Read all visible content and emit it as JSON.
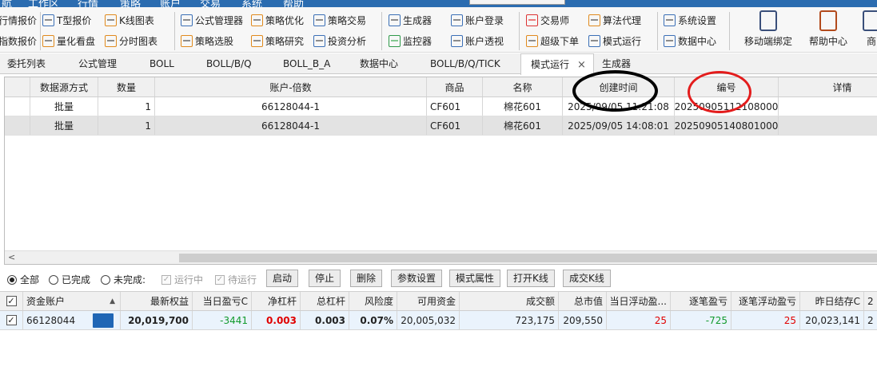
{
  "menubar": {
    "items": [
      "工作区",
      "行情",
      "策略",
      "账户",
      "交易",
      "系统",
      "帮助"
    ],
    "fragment": "航"
  },
  "ribbon": {
    "row1": [
      {
        "label": "行情报价",
        "icon": "quote-list-icon"
      },
      {
        "label": "T型报价",
        "icon": "t-quote-icon"
      },
      {
        "label": "K线图表",
        "icon": "candlestick-icon"
      },
      {
        "label": "公式管理器",
        "icon": "formula-icon"
      },
      {
        "label": "策略优化",
        "icon": "optimize-icon"
      },
      {
        "label": "策略交易",
        "icon": "strategy-trade-icon"
      },
      {
        "label": "生成器",
        "icon": "generator-icon"
      },
      {
        "label": "账户登录",
        "icon": "account-login-icon"
      },
      {
        "label": "交易师",
        "icon": "trader-icon"
      },
      {
        "label": "算法代理",
        "icon": "algo-proxy-icon"
      },
      {
        "label": "系统设置",
        "icon": "gear-icon"
      }
    ],
    "row2": [
      {
        "label": "指数报价",
        "icon": "index-quote-icon"
      },
      {
        "label": "量化看盘",
        "icon": "quant-view-icon"
      },
      {
        "label": "分时图表",
        "icon": "intraday-chart-icon"
      },
      {
        "label": "策略选股",
        "icon": "stock-picker-icon"
      },
      {
        "label": "策略研究",
        "icon": "research-icon"
      },
      {
        "label": "投资分析",
        "icon": "analysis-icon"
      },
      {
        "label": "监控器",
        "icon": "monitor-icon"
      },
      {
        "label": "账户透视",
        "icon": "account-view-icon"
      },
      {
        "label": "超级下单",
        "icon": "super-order-icon"
      },
      {
        "label": "模式运行",
        "icon": "mode-run-icon"
      },
      {
        "label": "数据中心",
        "icon": "data-center-icon"
      }
    ],
    "big": [
      {
        "label": "移动端绑定",
        "icon": "mobile-icon"
      },
      {
        "label": "帮助中心",
        "icon": "help-doc-icon"
      },
      {
        "label": "商",
        "icon": "store-icon"
      }
    ]
  },
  "tabs": [
    {
      "label": "委托列表"
    },
    {
      "label": "公式管理"
    },
    {
      "label": "BOLL"
    },
    {
      "label": "BOLL/B/Q"
    },
    {
      "label": "BOLL_B_A"
    },
    {
      "label": "数据中心"
    },
    {
      "label": "BOLL/B/Q/TICK"
    },
    {
      "label": "模式运行",
      "active": true,
      "close": "×"
    },
    {
      "label": "生成器"
    }
  ],
  "mode_grid": {
    "headers": [
      "数据源方式",
      "数量",
      "账户-倍数",
      "商品",
      "名称",
      "创建时间",
      "编号",
      "详情"
    ],
    "rows": [
      [
        "批量",
        "1",
        "66128044-1",
        "CF601",
        "棉花601",
        "2025/09/05 11:21:08",
        "20250905112108000",
        ""
      ],
      [
        "批量",
        "1",
        "66128044-1",
        "CF601",
        "棉花601",
        "2025/09/05 14:08:01",
        "20250905140801000",
        ""
      ]
    ],
    "scroll_left": "<"
  },
  "filters": {
    "all": "全部",
    "done": "已完成",
    "undone": "未完成:",
    "running": "运行中",
    "pending": "待运行",
    "check": "✓"
  },
  "buttons": [
    "启动",
    "停止",
    "删除",
    "参数设置",
    "模式属性",
    "打开K线",
    "成交K线"
  ],
  "account_grid": {
    "headers": [
      "资金账户",
      "最新权益",
      "当日盈亏C",
      "净杠杆",
      "总杠杆",
      "风险度",
      "可用资金",
      "成交额",
      "总市值",
      "当日浮动盈...",
      "逐笔盈亏",
      "逐笔浮动盈亏",
      "昨日结存C",
      "2"
    ],
    "sort_icon": "▲",
    "row": {
      "account": "66128044",
      "equity": "20,019,700",
      "day_pnl": "-3441",
      "net_leverage": "0.003",
      "total_leverage": "0.003",
      "risk": "0.07%",
      "available": "20,005,032",
      "turnover": "723,175",
      "market_value": "209,550",
      "day_float": "25",
      "trade_pnl": "-725",
      "trade_float": "25",
      "prev_balance": "20,023,141",
      "extra": "2"
    }
  },
  "colors": {
    "annotation_black": "#000000",
    "annotation_red": "#e31c1c",
    "profit": "#e00000",
    "loss": "#119a2c"
  }
}
